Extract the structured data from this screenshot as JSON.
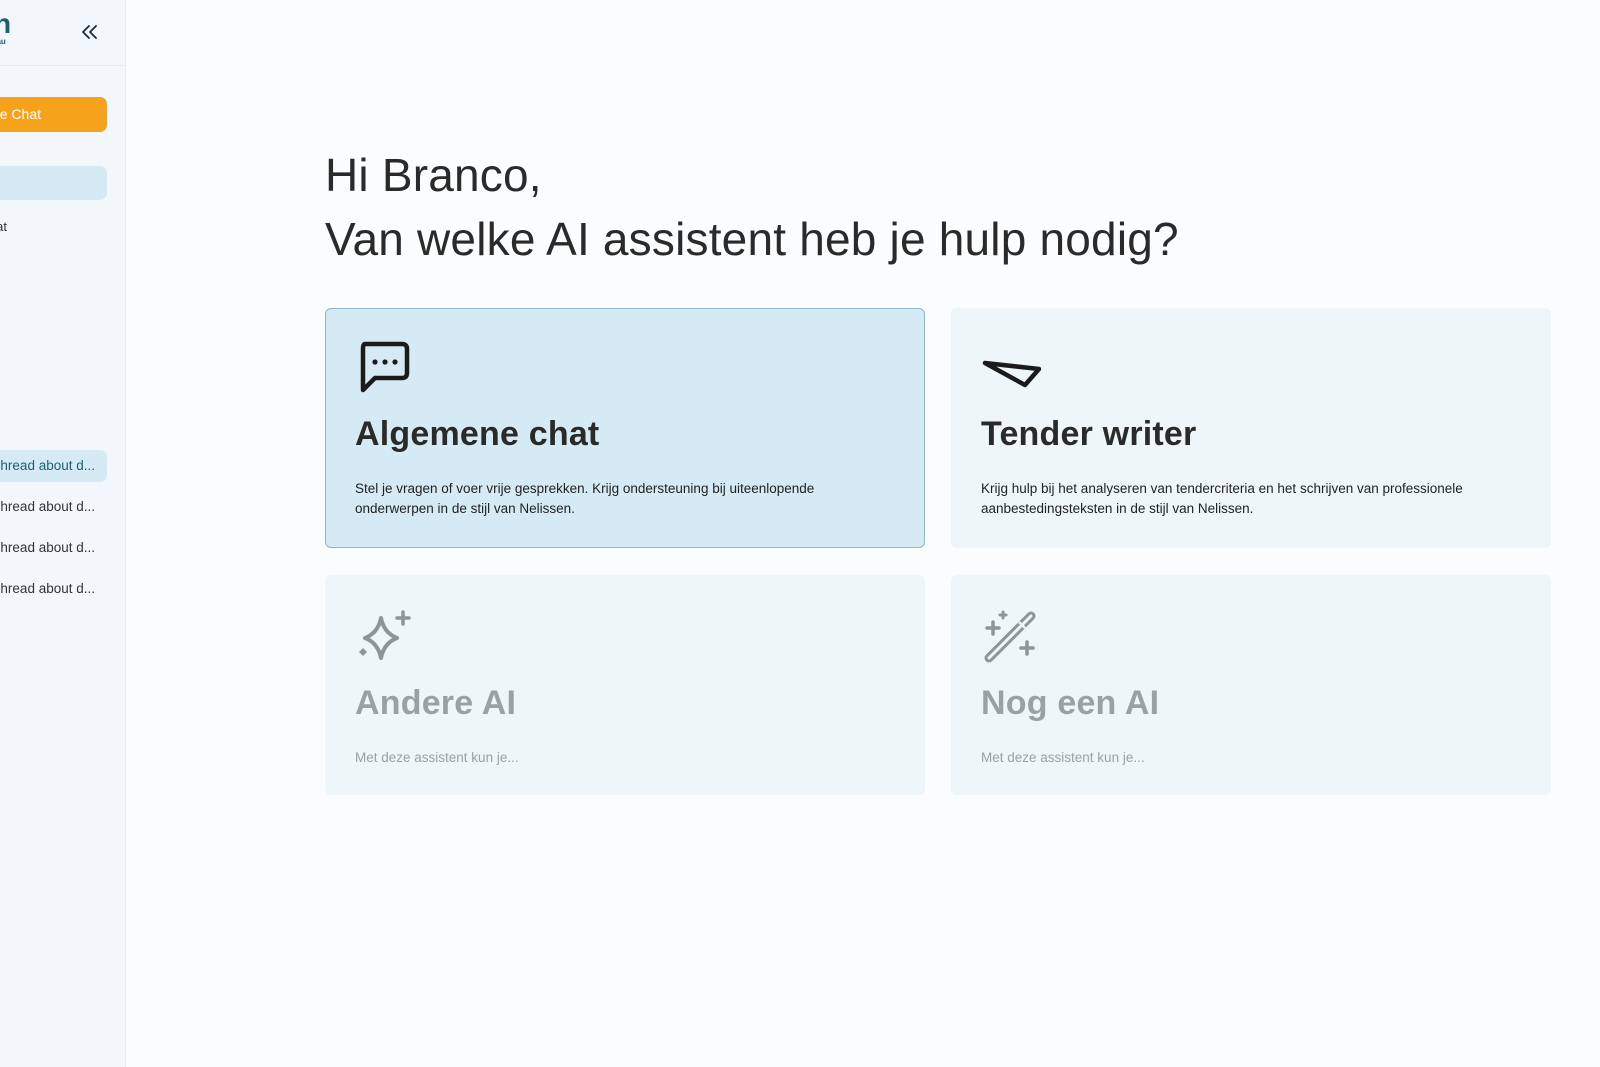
{
  "sidebar": {
    "logo": {
      "mark": "n",
      "subtitle": "eau"
    },
    "collapse_icon": "double-chevron-left-icon",
    "new_chat_label": "e Chat",
    "nav_item_2": "at",
    "threads": [
      {
        "label": "hread about d...",
        "active": true
      },
      {
        "label": "hread about d...",
        "active": false
      },
      {
        "label": "hread about d...",
        "active": false
      },
      {
        "label": "hread about d...",
        "active": false
      }
    ]
  },
  "main": {
    "greeting_line1": "Hi Branco,",
    "greeting_line2": "Van welke AI assistent heb je hulp nodig?",
    "cards": [
      {
        "icon": "chat-bubble-icon",
        "title": "Algemene chat",
        "description": "Stel je vragen of voer vrije gesprekken. Krijg ondersteuning bij uiteenlopende onderwerpen in de stijl van Nelissen.",
        "selected": true
      },
      {
        "icon": "send-icon",
        "title": "Tender writer",
        "description": "Krijg hulp bij het analyseren van tendercriteria en het schrijven van professionele aanbestedingsteksten in de stijl van Nelissen.",
        "selected": false
      },
      {
        "icon": "sparkle-icon",
        "title": "Andere AI",
        "description": "Met deze assistent kun je...",
        "disabled": true
      },
      {
        "icon": "magic-wand-icon",
        "title": "Nog een AI",
        "description": "Met deze assistent kun je...",
        "disabled": true
      }
    ]
  },
  "colors": {
    "accent_orange": "#f7a21b",
    "selected_card": "#d5eaf5",
    "card_bg": "#eef6fa",
    "brand": "#1f5d70"
  }
}
